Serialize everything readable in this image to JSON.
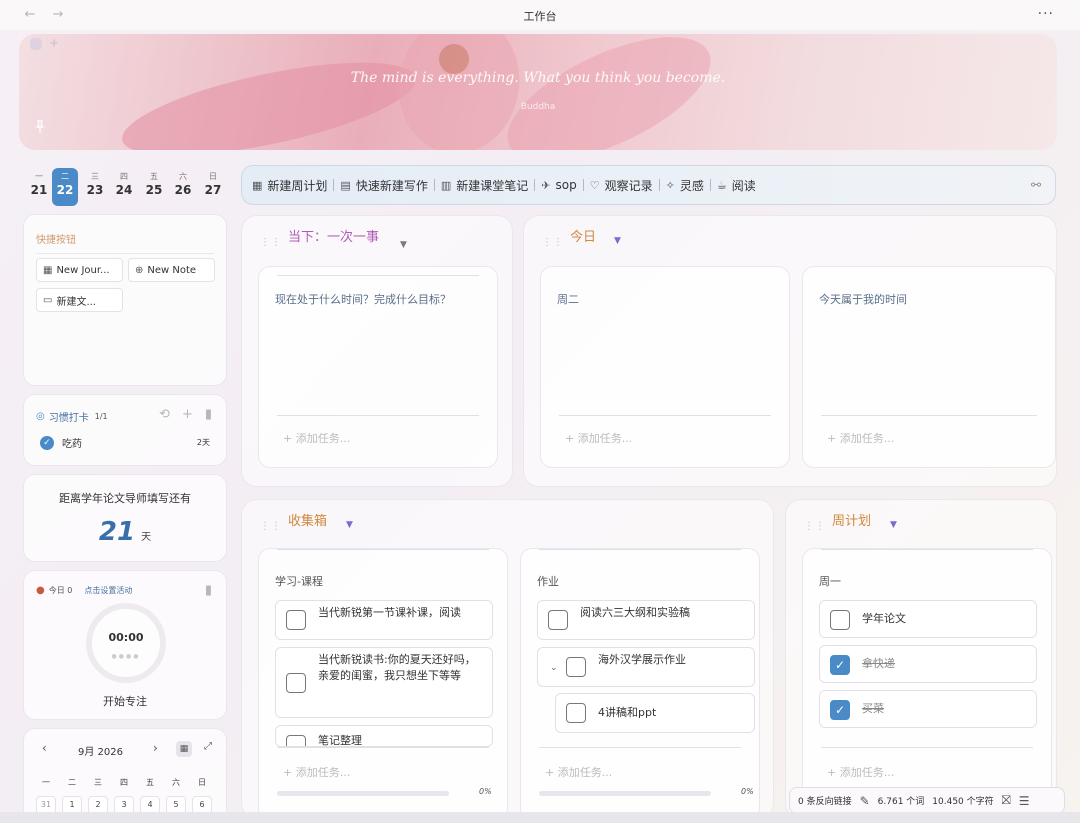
{
  "window": {
    "title": "工作台",
    "back_icon": "arrow-left-icon",
    "forward_icon": "arrow-right-icon",
    "more_label": "···"
  },
  "banner": {
    "quote": "The mind is everything. What you think you become.",
    "author": "Buddha"
  },
  "week": {
    "active_index": 1,
    "days": [
      {
        "weekday": "一",
        "date": "21"
      },
      {
        "weekday": "二",
        "date": "22"
      },
      {
        "weekday": "三",
        "date": "23"
      },
      {
        "weekday": "四",
        "date": "24"
      },
      {
        "weekday": "五",
        "date": "25"
      },
      {
        "weekday": "六",
        "date": "26"
      },
      {
        "weekday": "日",
        "date": "27"
      }
    ]
  },
  "quick_buttons": {
    "label": "快捷按钮",
    "items": [
      {
        "icon": "calendar-icon",
        "label": "New Jour..."
      },
      {
        "icon": "plus-circle-icon",
        "label": "New Note"
      },
      {
        "icon": "folder-icon",
        "label": "新建文..."
      }
    ]
  },
  "habit": {
    "title": "习惯打卡",
    "count": "1/1",
    "item": "吃药",
    "streak": "2天"
  },
  "countdown": {
    "title": "距离学年论文导师填写还有",
    "value": "21",
    "unit": "天"
  },
  "focus": {
    "today": "今日 0",
    "setup": "点击设置活动",
    "time": "00:00",
    "start": "开始专注"
  },
  "calendar": {
    "month": "9月 2026",
    "weekdays": [
      "一",
      "二",
      "三",
      "四",
      "五",
      "六",
      "日"
    ],
    "first_row": [
      "31",
      "1",
      "2",
      "3",
      "4",
      "5",
      "6"
    ]
  },
  "toolbar": {
    "items": [
      {
        "icon": "calendar-icon",
        "label": "新建周计划"
      },
      {
        "icon": "file-plus-icon",
        "label": "快速新建写作"
      },
      {
        "icon": "book-open-icon",
        "label": "新建课堂笔记"
      },
      {
        "icon": "plane-icon",
        "label": "sop"
      },
      {
        "icon": "heart-icon",
        "label": "观察记录"
      },
      {
        "icon": "sparkles-icon",
        "label": "灵感"
      },
      {
        "icon": "cup-icon",
        "label": "阅读"
      }
    ]
  },
  "panels": {
    "now": {
      "title": "当下：一次一事",
      "column_text": "现在处于什么时间？完成什么目标？",
      "add": "+ 添加任务..."
    },
    "today": {
      "title": "今日",
      "col1": "周二",
      "col2": "今天属于我的时间",
      "add": "+ 添加任务..."
    },
    "inbox": {
      "title": "收集箱",
      "col1": {
        "title": "学习-课程",
        "tasks": [
          "当代新锐第一节课补课，阅读",
          "当代新锐读书:你的夏天还好吗，亲爱的闺蜜，我只想坐下等等",
          "笔记整理"
        ]
      },
      "col2": {
        "title": "作业",
        "tasks": [
          "阅读六三大纲和实验稿",
          "海外汉学展示作业",
          "4讲稿和ppt"
        ]
      },
      "add": "+ 添加任务...",
      "pct": "0%"
    },
    "weekly": {
      "title": "周计划",
      "col_title": "周一",
      "tasks": [
        {
          "label": "学年论文",
          "done": false
        },
        {
          "label": "拿快递",
          "done": true
        },
        {
          "label": "买菜",
          "done": true
        }
      ],
      "add": "+ 添加任务..."
    }
  },
  "status": {
    "backlinks": "0 条反向链接",
    "words": "6.761 个词",
    "chars": "10.450 个字符"
  }
}
